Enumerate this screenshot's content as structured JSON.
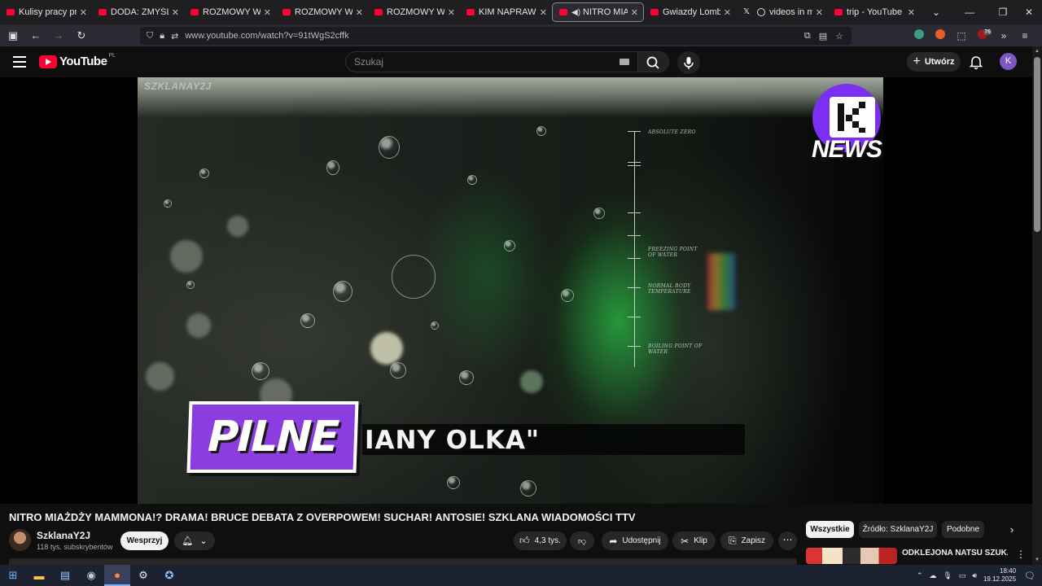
{
  "browser": {
    "tabs": [
      {
        "label": "Kulisy pracy prostytutki",
        "icon": "youtube-icon"
      },
      {
        "label": "DODA: ZMYŚLONE ZI",
        "icon": "youtube-icon"
      },
      {
        "label": "ROZMOWY W TOKU",
        "icon": "youtube-icon"
      },
      {
        "label": "ROZMOWY W TOKU",
        "icon": "youtube-icon"
      },
      {
        "label": "ROZMOWY W TOKU",
        "icon": "youtube-icon"
      },
      {
        "label": "KIM NAPRAWDĘ JEST",
        "icon": "youtube-icon"
      },
      {
        "label": "NITRO MIAŻDŻY",
        "icon": "youtube-icon",
        "active": true
      },
      {
        "label": "Gwiazdy Lombardu: I",
        "icon": "youtube-icon"
      },
      {
        "label": "videos in my folder",
        "icon": "x-icon"
      },
      {
        "label": "trip - YouTube",
        "icon": "youtube-icon"
      }
    ],
    "url": "www.youtube.com/watch?v=91tWgS2cffk",
    "ext_badge": "76"
  },
  "youtube": {
    "logo_text": "YouTube",
    "region": "PL",
    "search_placeholder": "Szukaj",
    "create_label": "Utwórz",
    "avatar_letter": "K"
  },
  "video": {
    "watermark": "SZKLANAY2J",
    "pilne": "PILNE",
    "lower_third": "IANY OLKA\"",
    "news_logo": "NEWS",
    "scale_labels": [
      "ABSOLUTE ZERO",
      "FREEZING POINT OF WATER",
      "NORMAL BODY TEMPERATURE",
      "BOILING POINT OF WATER"
    ]
  },
  "meta": {
    "title": "NITRO MIAŻDŻY MAMMONA!? DRAMA! BRUCE DEBATA Z OVERPOWEM! SUCHAR! ANTOSIE! SZKLANA WIADOMOŚCI TTV",
    "channel": "SzklanaY2J",
    "subscribers": "118 tys. subskrybentów",
    "support_label": "Wesprzyj",
    "likes": "4,3 tys.",
    "share_label": "Udostępnij",
    "clip_label": "Klip",
    "save_label": "Zapisz"
  },
  "chips": [
    "Wszystkie",
    "Źródło: SzklanaY2J",
    "Podobne"
  ],
  "recommended": {
    "title": "ODKLEJONA NATSU SZUKA BOGATEGO CHLOPAKA?"
  },
  "taskbar": {
    "time": "18:40",
    "date": "19.12.2025"
  },
  "colors": {
    "accent": "#ff0033",
    "purple": "#8b3de0",
    "avatar": "#7e57c2"
  }
}
